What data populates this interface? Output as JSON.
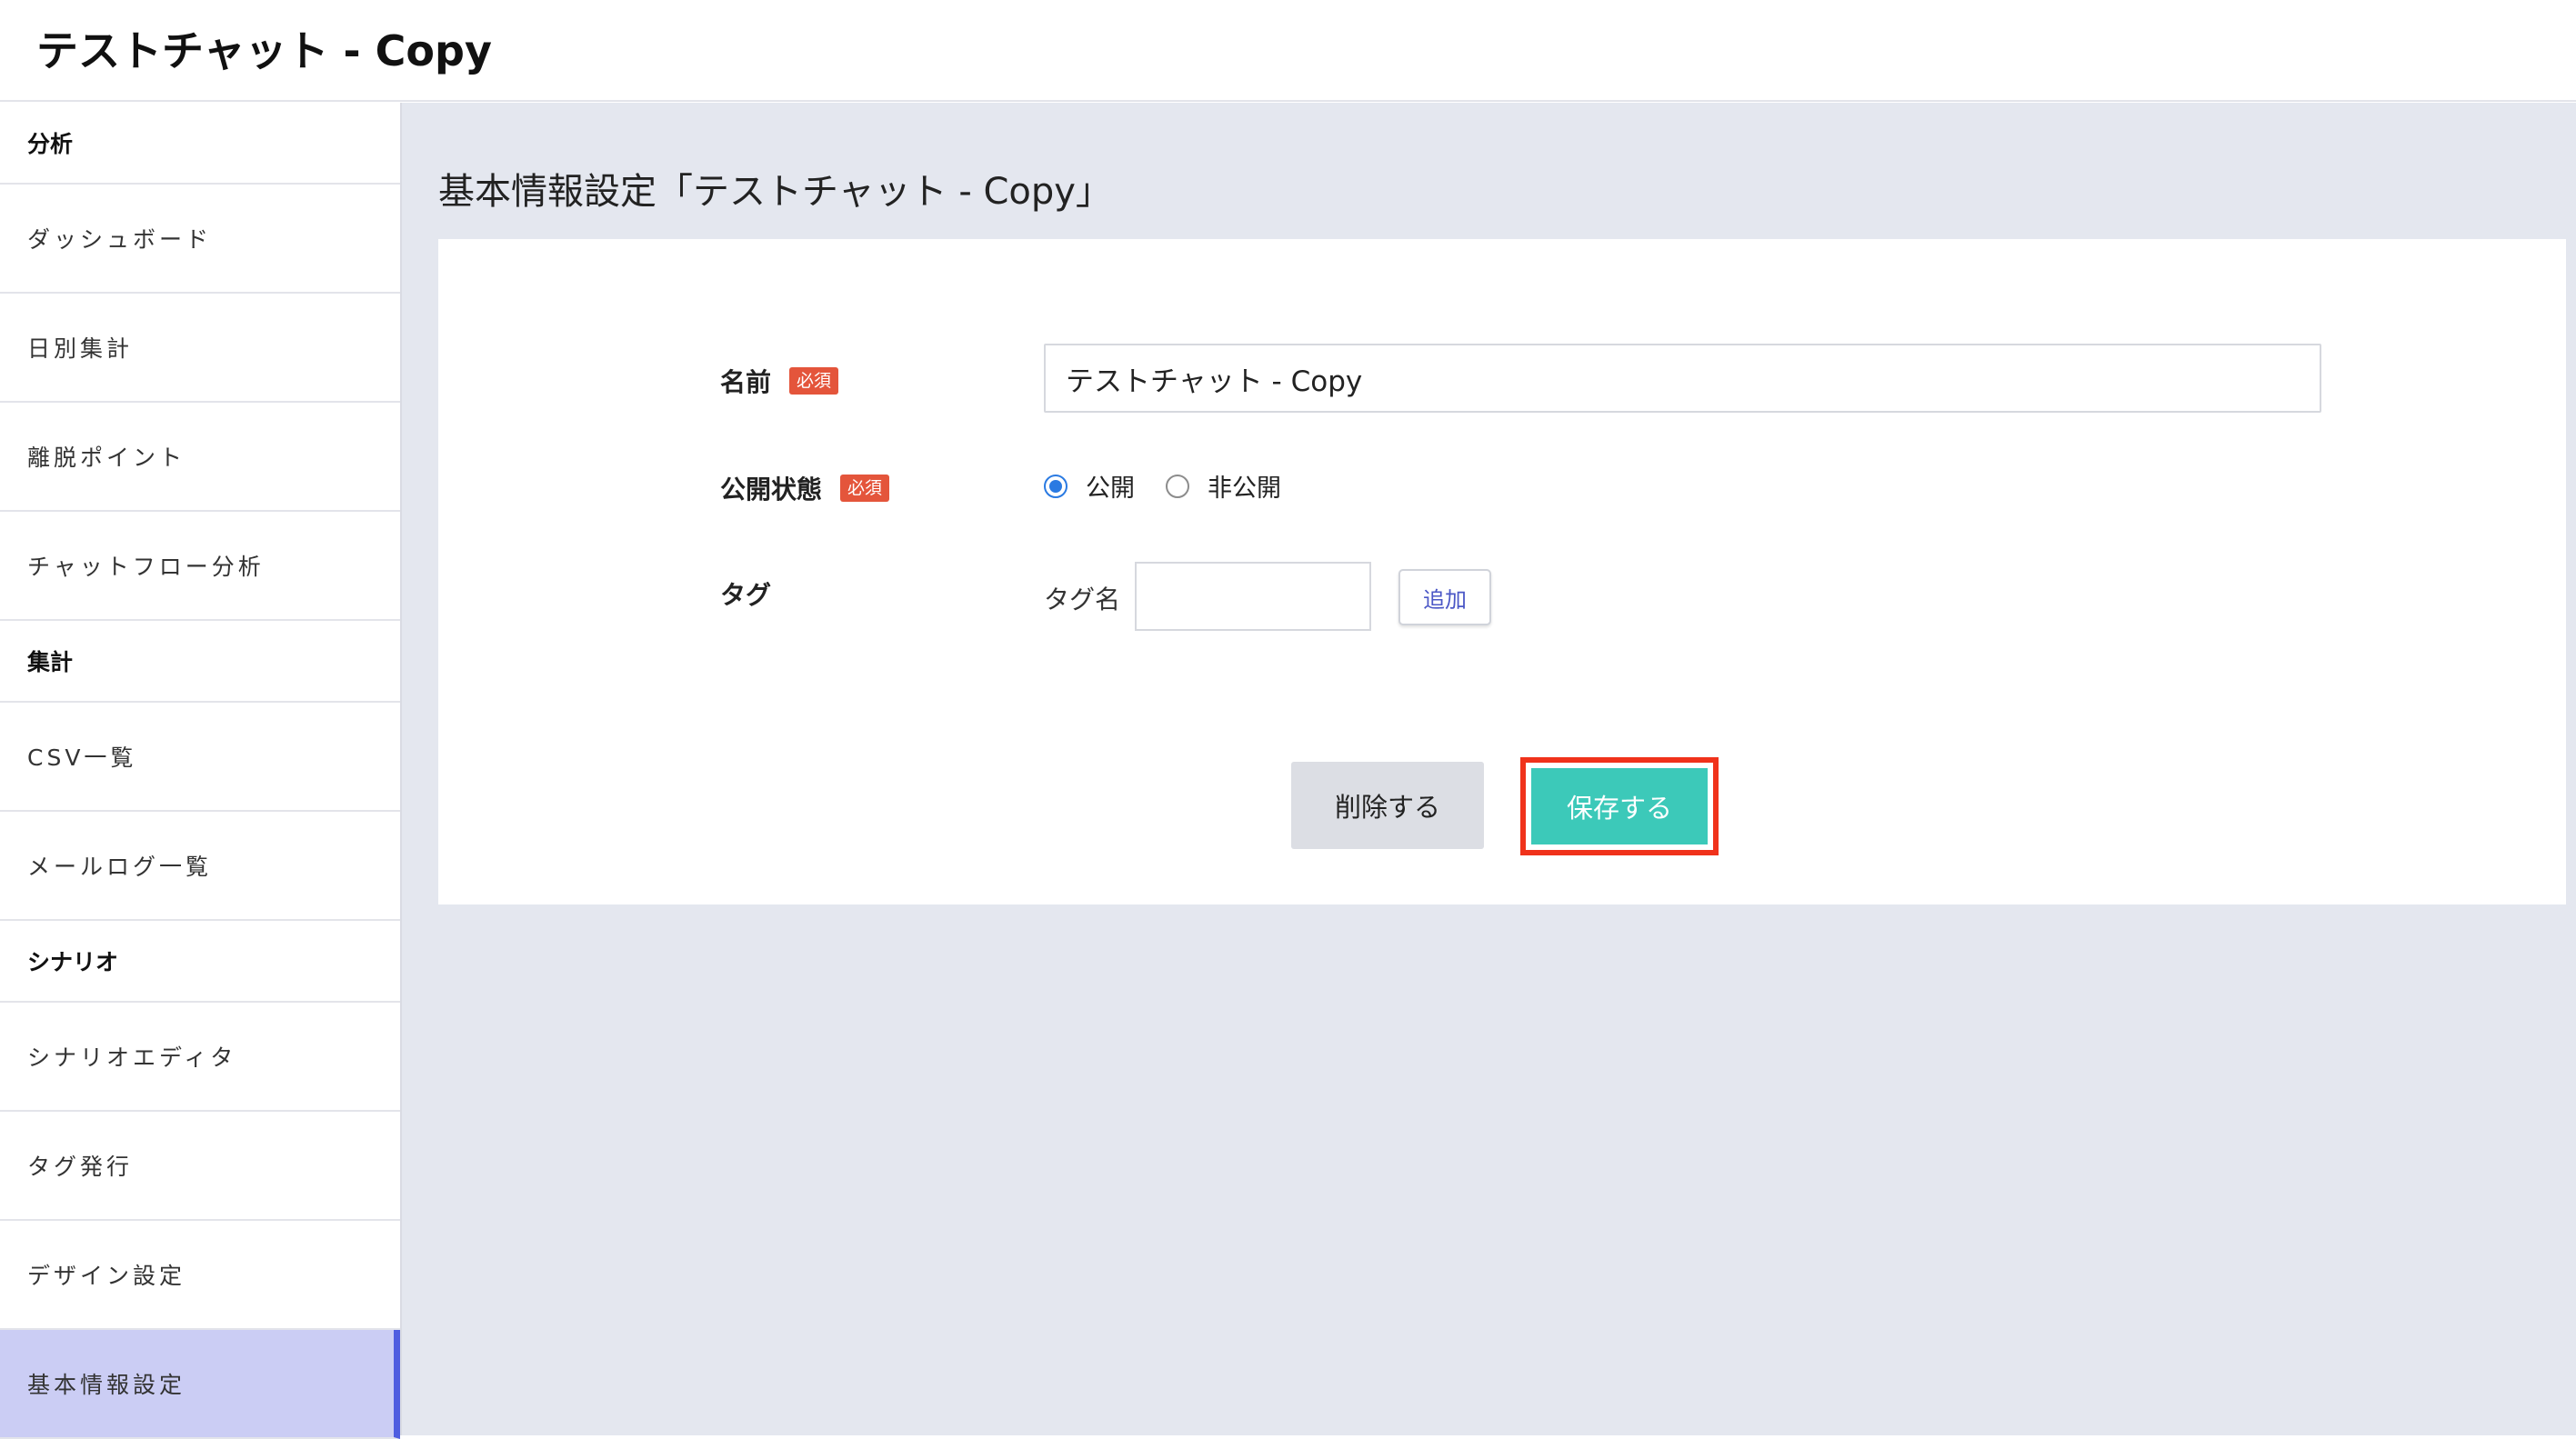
{
  "header": {
    "title": "テストチャット - Copy"
  },
  "sidebar": {
    "sections": [
      {
        "label": "分析",
        "items": [
          "ダッシュボード",
          "日別集計",
          "離脱ポイント",
          "チャットフロー分析"
        ]
      },
      {
        "label": "集計",
        "items": [
          "CSV一覧",
          "メールログ一覧"
        ]
      },
      {
        "label": "シナリオ",
        "items": [
          "シナリオエディタ",
          "タグ発行",
          "デザイン設定",
          "基本情報設定"
        ]
      }
    ],
    "active_item": "基本情報設定"
  },
  "main": {
    "page_title": "基本情報設定「テストチャット - Copy」",
    "form": {
      "name_label": "名前",
      "required_badge": "必須",
      "name_value": "テストチャット - Copy",
      "status_label": "公開状態",
      "radio_public": "公開",
      "radio_private": "非公開",
      "selected_status": "公開",
      "tag_label": "タグ",
      "tag_name_label": "タグ名",
      "tag_input_value": "",
      "add_button": "追加",
      "delete_button": "削除する",
      "save_button": "保存する"
    }
  },
  "colors": {
    "accent_teal": "#3cc9b9",
    "highlight_red": "#f0321b",
    "required_badge": "#e4553b",
    "sidebar_active": "#cbcdf4",
    "sidebar_active_bar": "#4f5de0",
    "main_bg": "#e4e7ef",
    "radio_blue": "#2a7ae2"
  }
}
